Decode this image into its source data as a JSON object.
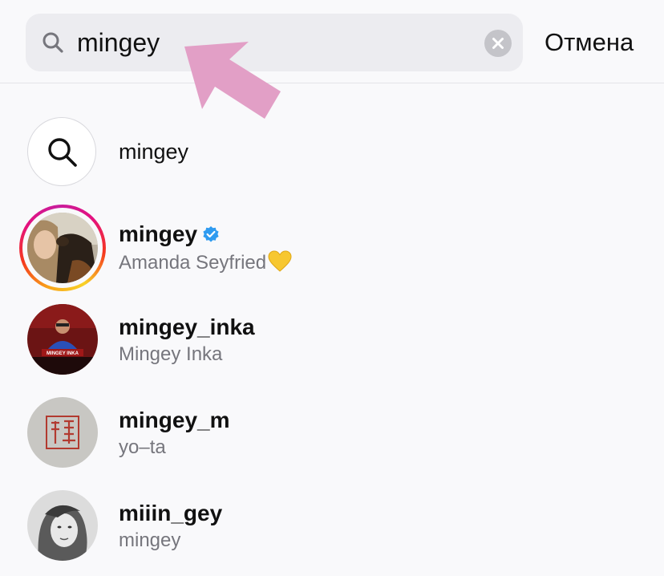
{
  "search": {
    "query": "mingey",
    "cancel_label": "Отмена"
  },
  "suggestion": {
    "label": "mingey"
  },
  "results": [
    {
      "username": "mingey",
      "full_name": "Amanda Seyfried",
      "verified": true,
      "has_story": true,
      "emoji": "yellow-heart"
    },
    {
      "username": "mingey_inka",
      "full_name": "Mingey Inka",
      "avatar_text": "MINGEY INKA"
    },
    {
      "username": "mingey_m",
      "full_name": "yo–ta"
    },
    {
      "username": "miiin_gey",
      "full_name": "mingey"
    }
  ],
  "colors": {
    "annotation_arrow": "#e29fc6",
    "verified_badge": "#2f9bf0",
    "story_ring": [
      "#f8a31a",
      "#e4117f",
      "#c81d9c"
    ]
  }
}
